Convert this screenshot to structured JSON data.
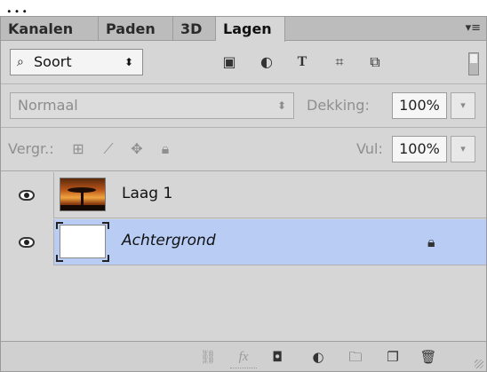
{
  "backdrop_text": "…",
  "tabs": [
    {
      "label": "Kanalen",
      "active": false
    },
    {
      "label": "Paden",
      "active": false
    },
    {
      "label": "3D",
      "active": false
    },
    {
      "label": "Lagen",
      "active": true
    }
  ],
  "panel_menu_icon": "panel-menu-icon",
  "filter": {
    "kind_label": "Soort",
    "icons": [
      "pixel-layer-filter-icon",
      "adjustment-layer-filter-icon",
      "type-layer-filter-icon",
      "shape-layer-filter-icon",
      "smart-object-filter-icon"
    ]
  },
  "blend": {
    "mode": "Normaal",
    "opacity_label": "Dekking:",
    "opacity_value": "100%"
  },
  "lock": {
    "label": "Vergr.:",
    "fill_label": "Vul:",
    "fill_value": "100%"
  },
  "layers": [
    {
      "name": "Laag 1",
      "thumbnail": "sunset-tree-photo",
      "selected": false,
      "locked": false
    },
    {
      "name": "Achtergrond",
      "thumbnail": "white",
      "selected": true,
      "locked": true
    }
  ],
  "footer_icons": [
    "link-layers-icon",
    "fx-icon",
    "mask-icon",
    "adjustment-layer-icon",
    "folder-icon",
    "new-layer-icon",
    "trash-icon"
  ],
  "colors": {
    "selected_row": "#b8ccf4",
    "panel_bg": "#d6d6d6",
    "tabbar_bg": "#bcbcbc"
  }
}
